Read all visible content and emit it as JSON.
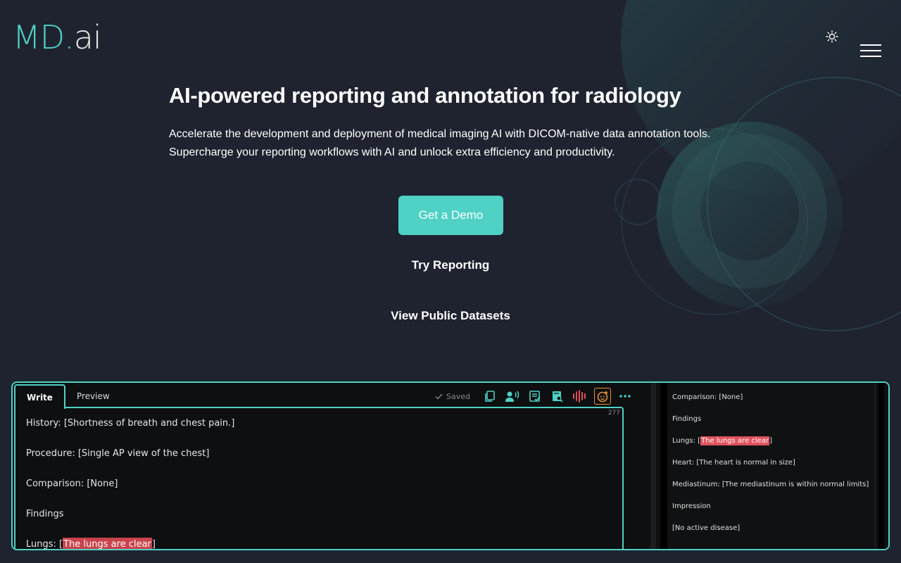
{
  "brand": {
    "logo_main": "MD",
    "logo_dot": ".",
    "logo_suffix": "ai",
    "accent": "#4fd1c5"
  },
  "header": {
    "theme_toggle_icon": "sun-icon",
    "menu_icon": "hamburger-menu-icon"
  },
  "hero": {
    "title": "AI-powered reporting and annotation for radiology",
    "subtitle_line1": "Accelerate the development and deployment of medical imaging AI with DICOM-native data annotation tools.",
    "subtitle_line2": "Supercharge your reporting workflows with AI and unlock extra efficiency and productivity.",
    "cta_label": "Get a Demo",
    "link_try": "Try Reporting",
    "link_datasets": "View Public Datasets"
  },
  "demo": {
    "tabs": [
      {
        "label": "Write"
      },
      {
        "label": "Preview"
      }
    ],
    "saved_label": "Saved",
    "char_count": "277",
    "toolbar_icons": [
      "copy-icon",
      "dictation-icon",
      "template-icon",
      "search-document-icon",
      "waveform-icon",
      "ai-assistant-icon",
      "more-icon"
    ],
    "editor_lines": {
      "history_prefix": "History: [",
      "history_value": "Shortness of breath and chest pain.",
      "history_suffix": "]",
      "procedure": "Procedure: [Single AP view of the chest]",
      "comparison": "Comparison: [None]",
      "findings": "Findings",
      "lungs_prefix": "Lungs: [",
      "lungs_value": "The lungs are clear",
      "lungs_suffix": "]"
    },
    "preview_lines": {
      "comparison": "Comparison: [None]",
      "findings": "Findings",
      "lungs_prefix": "Lungs: [",
      "lungs_value": "The lungs are clear",
      "lungs_suffix": "]",
      "heart": "Heart: [The heart is normal in size]",
      "mediastinum": "Mediastinum: [The mediastinum is within normal limits]",
      "impression": "Impression",
      "impression_value": "[No active disease]"
    }
  }
}
